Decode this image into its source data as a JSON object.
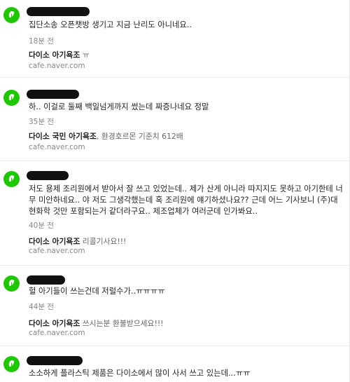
{
  "colors": {
    "accent": "#1ec800"
  },
  "icon": "leaf-icon",
  "results": [
    {
      "comment": "집단소송 오픈챗방 생기고 지금 난리도 아니네요..",
      "time": "18분 전",
      "post_cafe": "다이소 아기욕조",
      "post_rest": " ㅠ",
      "source": "cafe.naver.com"
    },
    {
      "comment": "하.. 이걸로 둘째 백일넘게까지 썼는데 짜증나네요 정말",
      "time": "35분 전",
      "post_cafe": "다이소 국민 아기욕조",
      "post_rest": ", 환경호르몬 기준치 612배",
      "source": "cafe.naver.com"
    },
    {
      "comment": "저도 용제 조리원에서 받아서 잘 쓰고 있었는데.. 제가 산게 아니라 따지지도 못하고 아기한테 너무 미안하네요.. 야 저도 그생각했는데 혹 조리원에 얘기하셨나요?? 근데 어느 기사보니 (주)대현화학 것만 포함되는거 같더라구요.. 제조업체가 여러군데 인가봐요..",
      "time": "40분 전",
      "post_cafe": "다이소 아기욕조",
      "post_rest": " 리콜기사요!!!",
      "source": "cafe.naver.com"
    },
    {
      "comment": "헐 아기들이 쓰는건데 저럴수가..ㅠㅠㅠㅠ",
      "time": "44분 전",
      "post_cafe": "다이소 아기욕조",
      "post_rest": " 쓰시는분 환불받으세요!!!",
      "source": "cafe.naver.com"
    },
    {
      "comment": "소소하게 플라스틱 제품은 다이소에서 많이 사서 쓰고 있는데...ㅠㅠ",
      "time": "",
      "post_cafe": "",
      "post_rest": "",
      "source": ""
    }
  ]
}
